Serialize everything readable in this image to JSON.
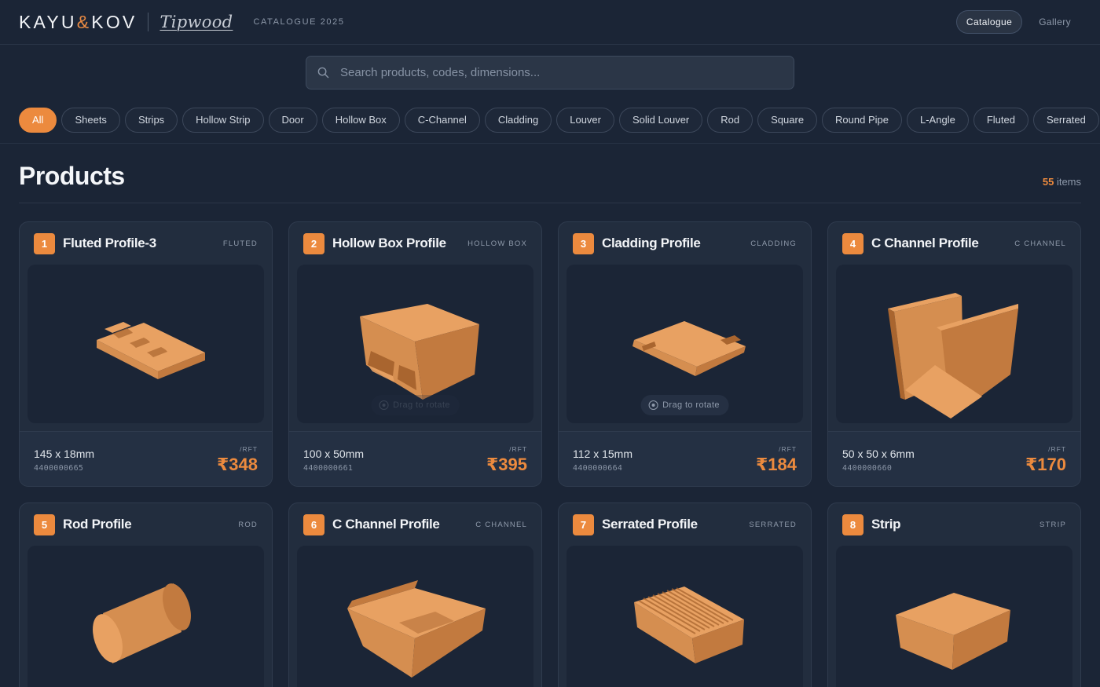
{
  "brand": {
    "main_left": "KAYU",
    "amp": "&",
    "main_right": "KOV",
    "sub": "Tipwood",
    "catalogue_label": "CATALOGUE 2025"
  },
  "nav": {
    "catalogue": "Catalogue",
    "gallery": "Gallery",
    "active": "Catalogue"
  },
  "search": {
    "placeholder": "Search products, codes, dimensions..."
  },
  "filters": {
    "active": "All",
    "items": [
      "All",
      "Sheets",
      "Strips",
      "Hollow Strip",
      "Door",
      "Hollow Box",
      "C-Channel",
      "Cladding",
      "Louver",
      "Solid Louver",
      "Rod",
      "Square",
      "Round Pipe",
      "L-Angle",
      "Fluted",
      "Serrated"
    ]
  },
  "products": {
    "title": "Products",
    "count": "55",
    "count_suffix": "items",
    "drag_hint": "Drag to rotate",
    "unit": "/RFT",
    "items": [
      {
        "number": "1",
        "name": "Fluted Profile-3",
        "category": "FLUTED",
        "dimensions": "145 x 18mm",
        "code": "4400000665",
        "price": "₹348"
      },
      {
        "number": "2",
        "name": "Hollow Box Profile",
        "category": "HOLLOW BOX",
        "dimensions": "100 x 50mm",
        "code": "4400000661",
        "price": "₹395"
      },
      {
        "number": "3",
        "name": "Cladding Profile",
        "category": "CLADDING",
        "dimensions": "112 x 15mm",
        "code": "4400000664",
        "price": "₹184"
      },
      {
        "number": "4",
        "name": "C Channel Profile",
        "category": "C CHANNEL",
        "dimensions": "50 x 50 x 6mm",
        "code": "4400000660",
        "price": "₹170"
      },
      {
        "number": "5",
        "name": "Rod Profile",
        "category": "ROD"
      },
      {
        "number": "6",
        "name": "C Channel Profile",
        "category": "C CHANNEL"
      },
      {
        "number": "7",
        "name": "Serrated Profile",
        "category": "SERRATED"
      },
      {
        "number": "8",
        "name": "Strip",
        "category": "STRIP"
      }
    ]
  },
  "colors": {
    "accent": "#ec8a3e",
    "background": "#1b2536",
    "card": "#222d3e",
    "wood_top": "#e8a162",
    "wood_side": "#c27a3f",
    "wood_front": "#d58e50"
  },
  "icons": {
    "search": "search-icon",
    "drag": "rotate-icon"
  }
}
